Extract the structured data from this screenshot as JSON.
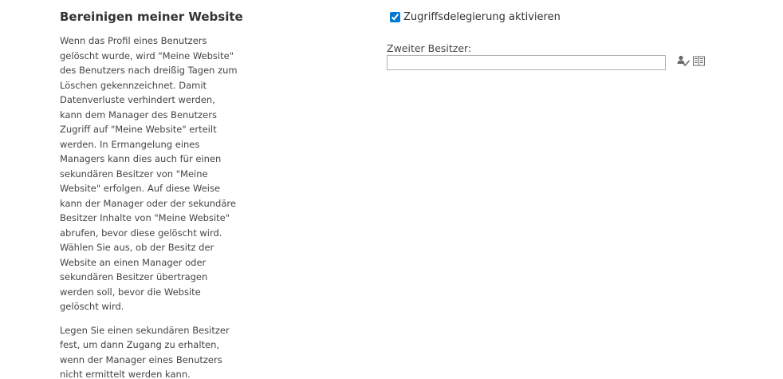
{
  "section": {
    "title": "Bereinigen meiner Website",
    "paragraphs": [
      "Wenn das Profil eines Benutzers gelöscht wurde, wird \"Meine Website\" des Benutzers nach dreißig Tagen zum Löschen gekennzeichnet. Damit Datenverluste verhindert werden, kann dem Manager des Benutzers Zugriff auf \"Meine Website\" erteilt werden. In Ermangelung eines Managers kann dies auch für einen sekundären Besitzer von \"Meine Website\" erfolgen. Auf diese Weise kann der Manager oder der sekundäre Besitzer Inhalte von \"Meine Website\" abrufen, bevor diese gelöscht wird. Wählen Sie aus, ob der Besitz der Website an einen Manager oder sekundären Besitzer übertragen werden soll, bevor die Website gelöscht wird.",
      "Legen Sie einen sekundären Besitzer fest, um dann Zugang zu erhalten, wenn der Manager eines Benutzers nicht ermittelt werden kann."
    ]
  },
  "delegation": {
    "checkbox_label": "Zugriffsdelegierung aktivieren",
    "checked": true
  },
  "secondary_owner": {
    "label": "Zweiter Besitzer:",
    "value": "",
    "placeholder": ""
  },
  "icons": {
    "check_names": "check-names-icon",
    "browse": "address-book-icon",
    "accent": "#0078d4",
    "icon_color": "#6a6a6a"
  }
}
